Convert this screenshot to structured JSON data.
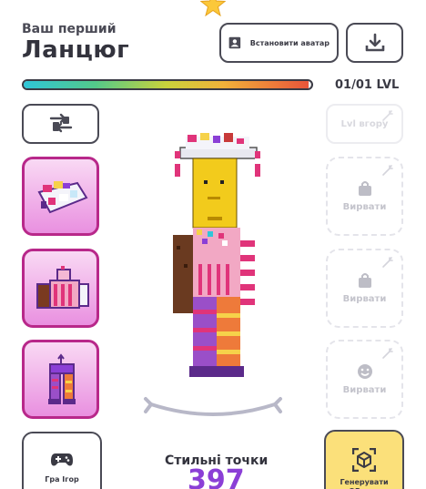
{
  "header": {
    "subtitle": "Ваш перший",
    "title": "Ланцюг",
    "set_avatar_label": "Встановити аватар"
  },
  "progress": {
    "level_text": "01/01 LVL",
    "fill_fraction": 0.99
  },
  "actions": {
    "level_up_label": "Lvl вгору"
  },
  "slots": [
    {
      "label": "Вирвати",
      "icon": "bag-icon"
    },
    {
      "label": "Вирвати",
      "icon": "bag-icon"
    },
    {
      "label": "Вирвати",
      "icon": "face-icon"
    }
  ],
  "footer": {
    "game_label": "Гра Ігор",
    "style_points_label": "Стильні точки",
    "style_points_value": "397",
    "generate_qr_label": "Генерувати QR-код"
  },
  "colors": {
    "accent_purple": "#8b3fd6",
    "card_magenta": "#b8288a",
    "qr_yellow": "#fbe07a"
  }
}
